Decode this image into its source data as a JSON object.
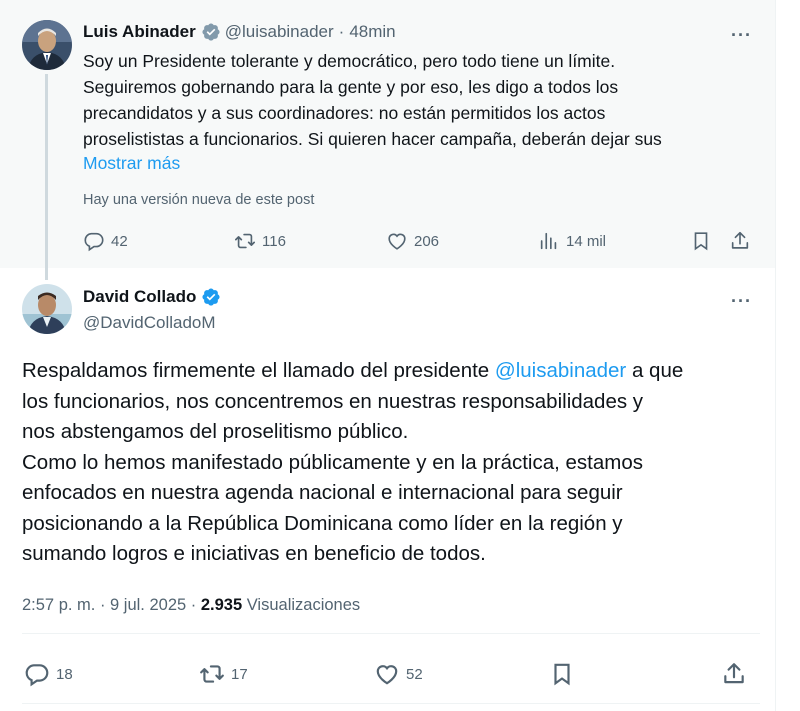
{
  "parent_post": {
    "author_name": "Luis Abinader",
    "handle": "@luisabinader",
    "separator": "·",
    "time": "48min",
    "text_lines": [
      "Soy un Presidente tolerante y democrático, pero todo tiene un límite.",
      "Seguiremos gobernando para la gente y por eso, les digo a todos los",
      "precandidatos y a sus coordinadores: no están permitidos los actos",
      "proselististas a funcionarios. Si quieren hacer campaña, deberán dejar sus"
    ],
    "show_more": "Mostrar más",
    "edited_notice": "Hay una versión nueva de este post",
    "replies": "42",
    "reposts": "116",
    "likes": "206",
    "views": "14 mil"
  },
  "main_post": {
    "author_name": "David Collado",
    "handle": "@DavidColladoM",
    "text_line1_before": "Respaldamos firmemente el llamado del presidente ",
    "text_line1_mention": "@luisabinader",
    "text_line1_after": " a que",
    "text_lines": [
      "los funcionarios, nos concentremos en nuestras responsabilidades y",
      "nos abstengamos del proselitismo público.",
      "Como lo hemos manifestado públicamente y en la práctica, estamos",
      "enfocados en nuestra agenda nacional e internacional para seguir",
      "posicionando a la República Dominicana como líder en la región y",
      "sumando logros e iniciativas en beneficio de todos."
    ],
    "timestamp": "2:57 p. m. · 9 jul. 2025 · ",
    "views_count": "2.935",
    "views_label": " Visualizaciones",
    "replies": "18",
    "reposts": "17",
    "likes": "52"
  },
  "more_menu": "···",
  "colors": {
    "accent": "#1d9bf0",
    "muted": "#536471",
    "text": "#0f1419",
    "verified": "#1d9bf0"
  },
  "icons": [
    "verified-badge-icon",
    "more-icon",
    "reply-icon",
    "repost-icon",
    "like-icon",
    "views-icon",
    "bookmark-icon",
    "share-icon"
  ]
}
